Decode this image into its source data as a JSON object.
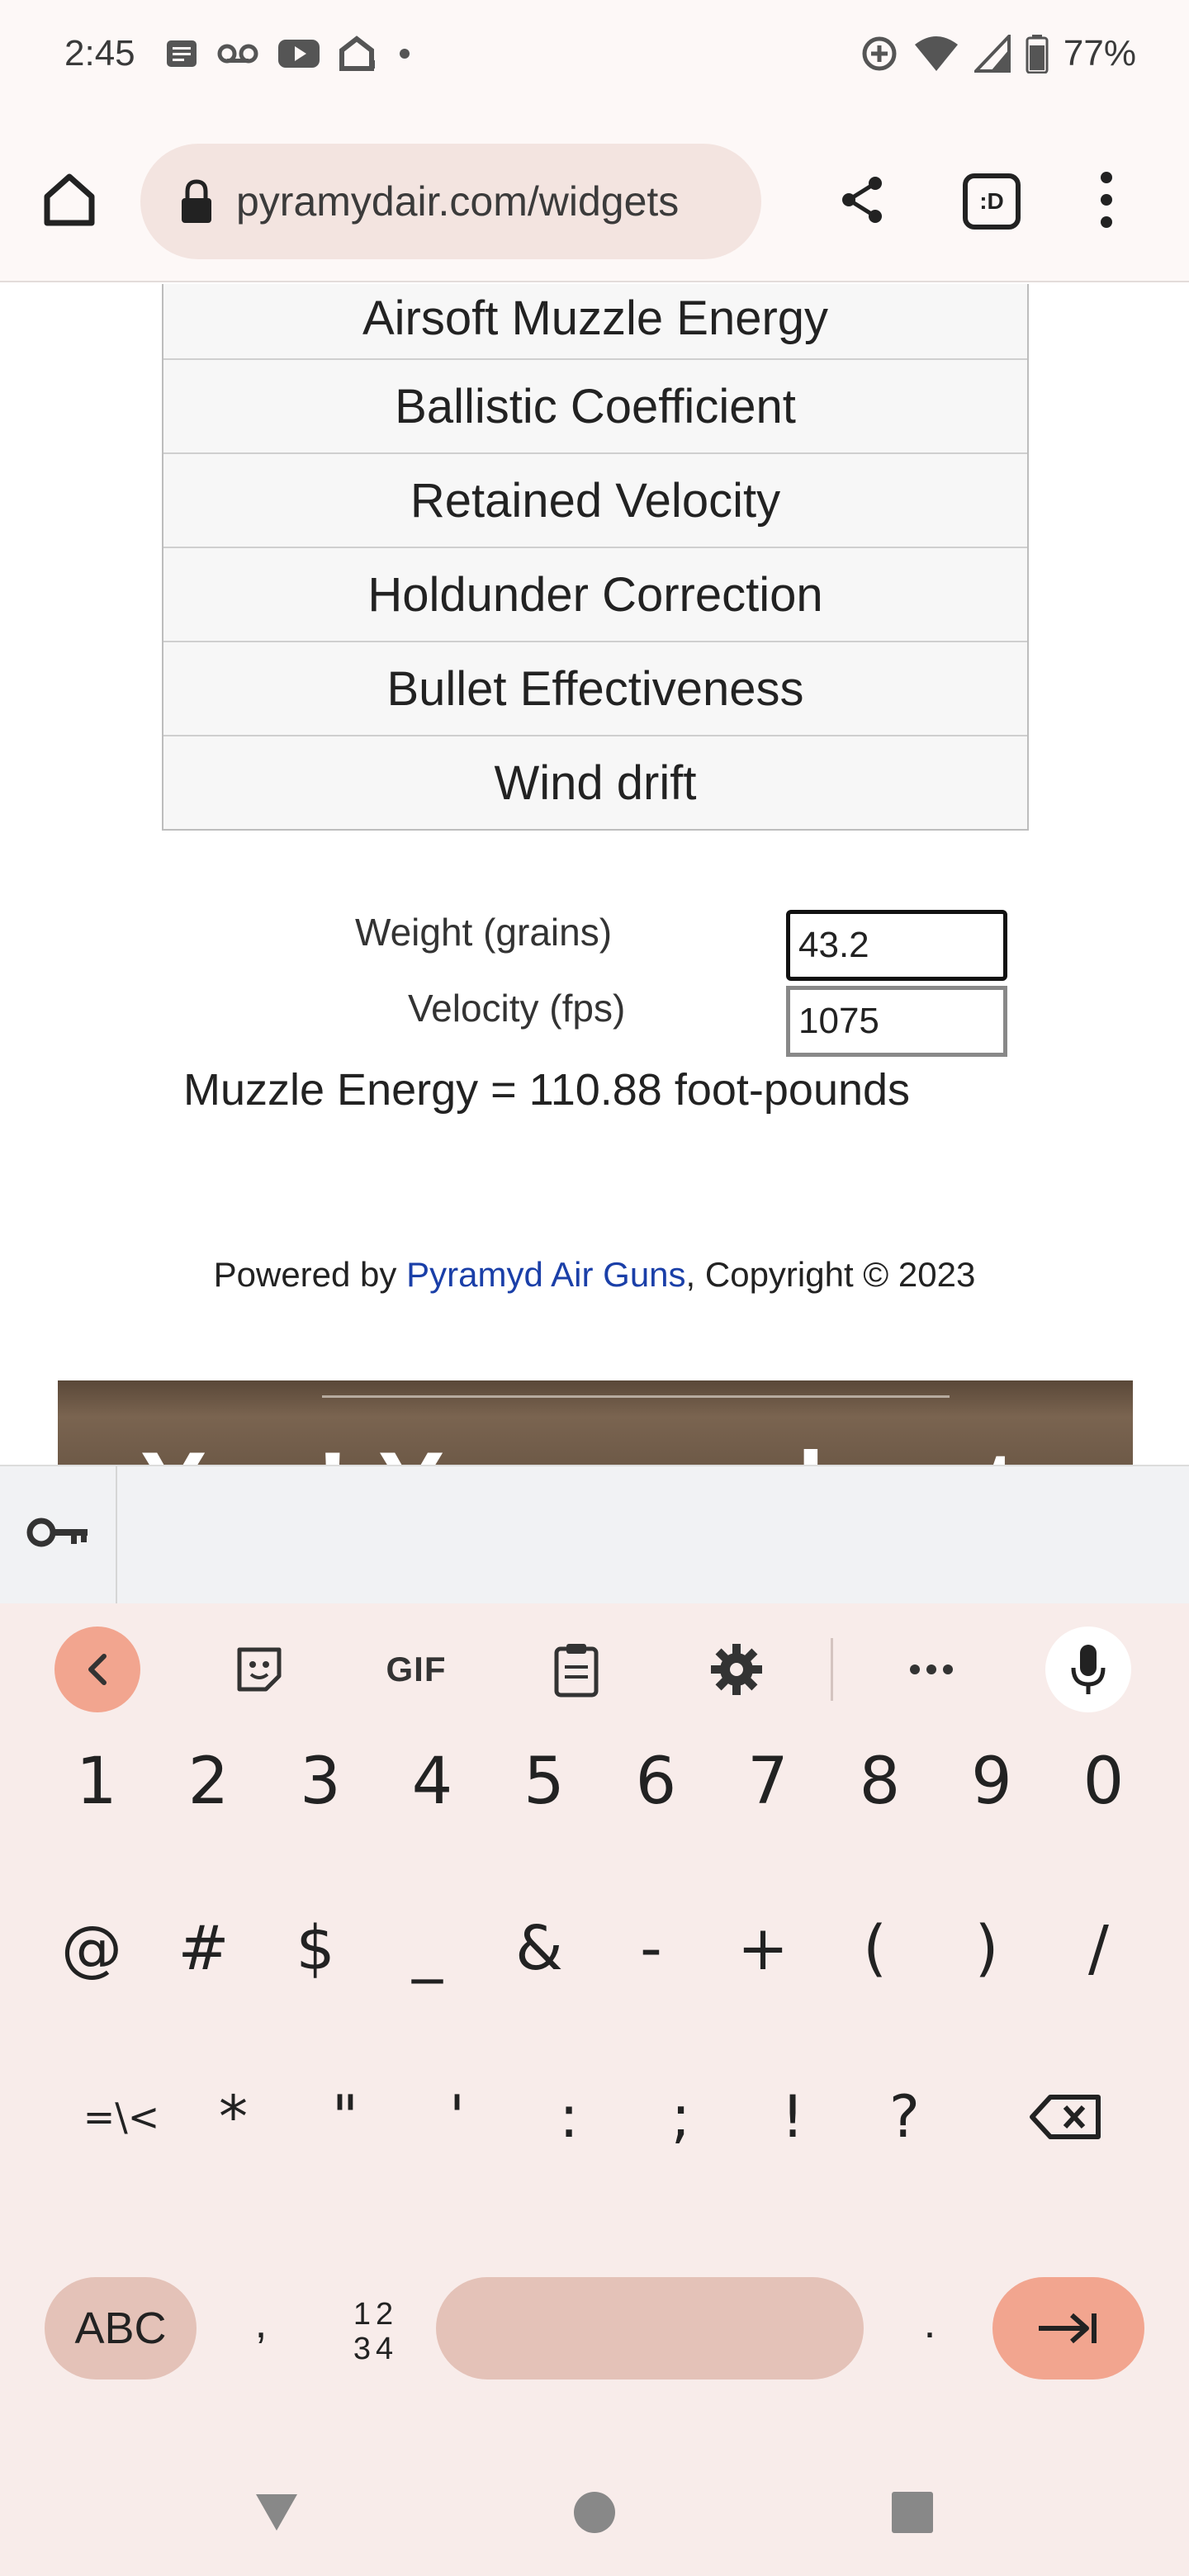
{
  "status_bar": {
    "time": "2:45",
    "battery": "77%",
    "left_icons": [
      "notes-icon",
      "voicemail-icon",
      "youtube-icon",
      "home-alert-icon",
      "dot-icon"
    ],
    "right_icons": [
      "data-saver-icon",
      "wifi-icon",
      "signal-icon",
      "battery-icon"
    ]
  },
  "browser": {
    "url": "pyramydair.com/widgets",
    "tab_switcher_label": ":D"
  },
  "calculator_menu": {
    "items": [
      "Airsoft Muzzle Energy",
      "Ballistic Coefficient",
      "Retained Velocity",
      "Holdunder Correction",
      "Bullet Effectiveness",
      "Wind drift"
    ]
  },
  "form": {
    "weight_label": "Weight (grains)",
    "weight_value": "43.2",
    "velocity_label": "Velocity (fps)",
    "velocity_value": "1075",
    "result": "Muzzle Energy = 110.88 foot-pounds"
  },
  "footer": {
    "prefix": "Powered by ",
    "link": "Pyramyd Air Guns",
    "suffix": ", Copyright © 2023"
  },
  "banner": {
    "text": "Yes! You can hunt"
  },
  "keyboard": {
    "number_row": [
      "1",
      "2",
      "3",
      "4",
      "5",
      "6",
      "7",
      "8",
      "9",
      "0"
    ],
    "symbol_row": [
      "@",
      "#",
      "$",
      "_",
      "&",
      "-",
      "+",
      "(",
      ")",
      "/"
    ],
    "symbol_row2": [
      "=\\<",
      "*",
      "\"",
      "'",
      ":",
      ";",
      "!",
      "?"
    ],
    "abc_label": "ABC",
    "comma": ",",
    "numpad_label": "12\n34",
    "period": ".",
    "gif_label": "GIF"
  },
  "colors": {
    "link": "#1a3fa8",
    "keyboard_bg": "#f8ecea",
    "accent_key": "#f2a58f",
    "space_key": "#e4c2b8"
  }
}
